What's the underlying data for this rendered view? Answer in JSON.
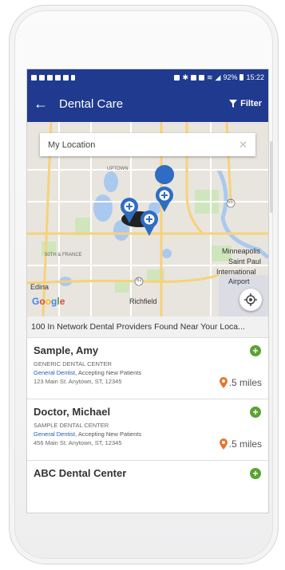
{
  "status": {
    "left_icons": [
      "message-icon",
      "wrench-icon",
      "mail-icon",
      "mail-icon",
      "image-icon",
      "download-icon"
    ],
    "battery": "92%",
    "time": "15:22"
  },
  "appbar": {
    "title": "Dental Care",
    "filter_label": "Filter"
  },
  "search": {
    "value": "My Location"
  },
  "map": {
    "labels": {
      "minneapolis": "Minneapolis",
      "saint_paul": "Saint Paul",
      "international": "International",
      "airport": "Airport",
      "edina": "Edina",
      "richfield": "Richfield",
      "uptown": "UPTOWN",
      "france": "50TH & FRANCE",
      "hwy55": "55",
      "hwy62": "62",
      "google": "Google"
    }
  },
  "results_summary": "100 In Network Dental Providers Found Near Your Loca...",
  "providers": [
    {
      "name": "Sample, Amy",
      "practice": "GENERIC DENTAL CENTER",
      "specialty": "General Dentist",
      "status": ", Accepting New Patients",
      "address": "123 Main St. Anytown, ST, 12345",
      "distance": ".5 miles"
    },
    {
      "name": "Doctor, Michael",
      "practice": "SAMPLE DENTAL CENTER",
      "specialty": "General Dentist",
      "status": ", Accepting New Patients",
      "address": "456 Main St. Anytown, ST, 12345",
      "distance": ".5 miles"
    },
    {
      "name": "ABC Dental Center"
    }
  ],
  "colors": {
    "primary": "#1f3a8f",
    "add": "#5aa332",
    "distance_pin": "#e8742a",
    "link": "#2a5ac0"
  }
}
